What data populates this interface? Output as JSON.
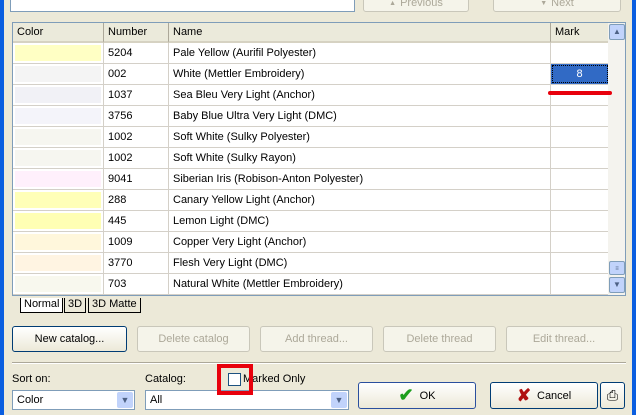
{
  "nav": {
    "previous": "Previous",
    "next": "Next"
  },
  "grid": {
    "headers": {
      "color": "Color",
      "number": "Number",
      "name": "Name",
      "mark": "Mark"
    },
    "rows": [
      {
        "color": "#ffffc4",
        "number": "5204",
        "name": "Pale Yellow (Aurifil Polyester)",
        "mark": ""
      },
      {
        "color": "#f4f4f4",
        "number": "002",
        "name": "White (Mettler Embroidery)",
        "mark": "8"
      },
      {
        "color": "#f1f1f6",
        "number": "1037",
        "name": "Sea Bleu Very Light (Anchor)",
        "mark": ""
      },
      {
        "color": "#f4f4fa",
        "number": "3756",
        "name": "Baby Blue Ultra Very Light (DMC)",
        "mark": ""
      },
      {
        "color": "#f6f6f0",
        "number": "1002",
        "name": "Soft White (Sulky Polyester)",
        "mark": ""
      },
      {
        "color": "#f6f6f0",
        "number": "1002",
        "name": "Soft White (Sulky Rayon)",
        "mark": ""
      },
      {
        "color": "#fff0fc",
        "number": "9041",
        "name": "Siberian Iris (Robison-Anton Polyester)",
        "mark": ""
      },
      {
        "color": "#ffffb8",
        "number": "288",
        "name": "Canary Yellow Light (Anchor)",
        "mark": ""
      },
      {
        "color": "#ffffb4",
        "number": "445",
        "name": "Lemon Light (DMC)",
        "mark": ""
      },
      {
        "color": "#fff7dc",
        "number": "1009",
        "name": "Copper Very Light (Anchor)",
        "mark": ""
      },
      {
        "color": "#fff4e2",
        "number": "3770",
        "name": "Flesh Very Light (DMC)",
        "mark": ""
      },
      {
        "color": "#f8f8ee",
        "number": "703",
        "name": "Natural White (Mettler Embroidery)",
        "mark": ""
      }
    ]
  },
  "tabs": [
    "Normal",
    "3D",
    "3D Matte"
  ],
  "buttons": {
    "new_catalog": "New catalog...",
    "delete_catalog": "Delete catalog",
    "add_thread": "Add thread...",
    "delete_thread": "Delete thread",
    "edit_thread": "Edit thread...",
    "ok": "OK",
    "cancel": "Cancel"
  },
  "sort": {
    "label": "Sort on:",
    "value": "Color"
  },
  "catalog": {
    "label": "Catalog:",
    "value": "All"
  },
  "marked_only": {
    "label": "Marked Only",
    "checked": false
  },
  "colors": {
    "selection": "#316ac5",
    "annotation": "#e8000c"
  }
}
